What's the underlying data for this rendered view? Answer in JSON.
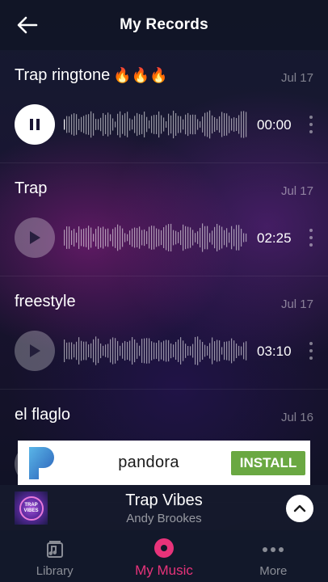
{
  "header": {
    "title": "My Records",
    "back_icon": "arrow-left-icon"
  },
  "records": [
    {
      "title": "Trap ringtone",
      "emoji": "🔥🔥🔥",
      "date": "Jul 17",
      "time": "00:00",
      "state": "playing"
    },
    {
      "title": "Trap",
      "emoji": "",
      "date": "Jul 17",
      "time": "02:25",
      "state": "paused"
    },
    {
      "title": "freestyle",
      "emoji": "",
      "date": "Jul 17",
      "time": "03:10",
      "state": "paused"
    },
    {
      "title": "el flaglo",
      "emoji": "",
      "date": "Jul 16",
      "time": "",
      "state": "paused"
    }
  ],
  "ad": {
    "brand": "pandora",
    "install_label": "INSTALL",
    "install_color": "#6aa842"
  },
  "now_playing": {
    "title": "Trap Vibes",
    "artist": "Andy Brookes",
    "art_text": "TRAP VIBES"
  },
  "nav": {
    "items": [
      {
        "label": "Library",
        "icon": "music-library-icon",
        "active": false
      },
      {
        "label": "My Music",
        "icon": "record-icon",
        "active": true
      },
      {
        "label": "More",
        "icon": "more-dots-icon",
        "active": false
      }
    ],
    "accent": "#e8337a"
  }
}
